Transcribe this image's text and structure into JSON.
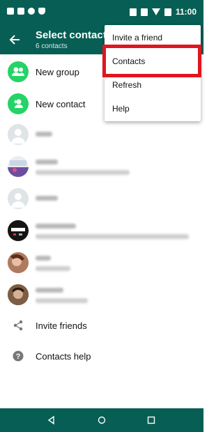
{
  "status_bar": {
    "time": "11:00"
  },
  "app_bar": {
    "title": "Select contact",
    "subtitle": "6 contacts"
  },
  "actions": [
    {
      "label": "New group",
      "icon": "group-icon"
    },
    {
      "label": "New contact",
      "icon": "add-contact-icon"
    }
  ],
  "footer_items": [
    {
      "label": "Invite friends",
      "icon": "share-icon"
    },
    {
      "label": "Contacts help",
      "icon": "help-icon"
    }
  ],
  "overflow_menu": {
    "items": [
      "Invite a friend",
      "Contacts",
      "Refresh",
      "Help"
    ],
    "highlighted": "Contacts"
  },
  "colors": {
    "primary": "#075e54",
    "accent": "#25d366",
    "highlight_box": "#e0151f"
  }
}
